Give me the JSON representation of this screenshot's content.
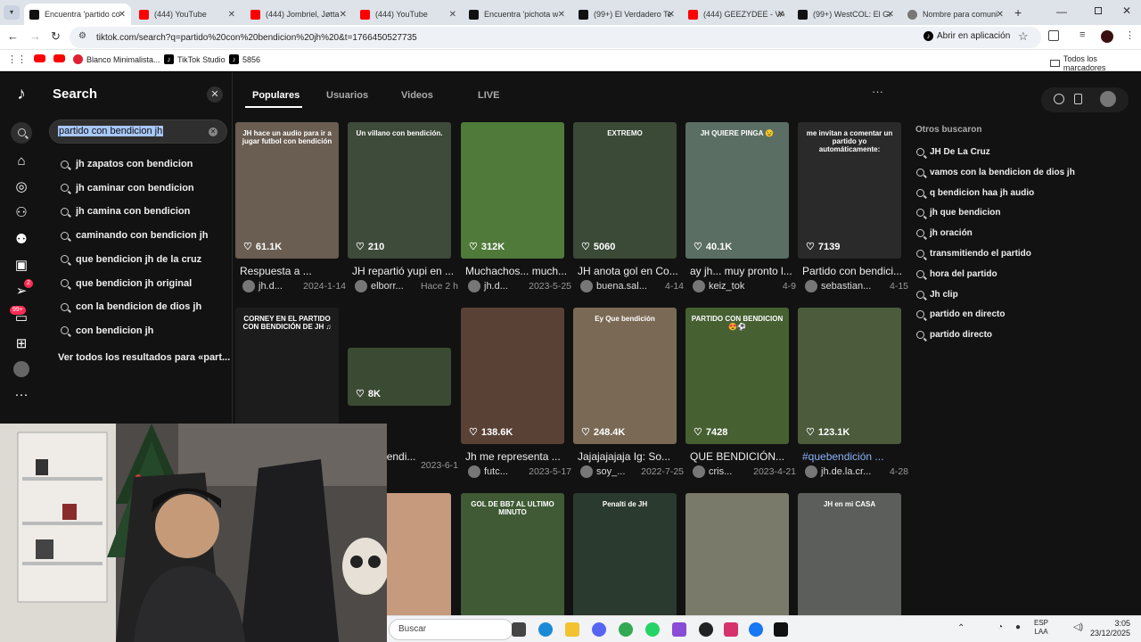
{
  "browser": {
    "tabs": [
      {
        "label": "Encuentra 'partido co",
        "icon": "tiktok-icon",
        "active": true
      },
      {
        "label": "(444) YouTube",
        "icon": "youtube-icon"
      },
      {
        "label": "(444) Jombriel, Jøtta",
        "icon": "youtube-icon"
      },
      {
        "label": "(444) YouTube",
        "icon": "youtube-icon"
      },
      {
        "label": "Encuentra 'pichota w",
        "icon": "tiktok-icon"
      },
      {
        "label": "(99+) El Verdadero Te",
        "icon": "tiktok-icon"
      },
      {
        "label": "(444) GEEZYDEE - VA",
        "icon": "youtube-icon"
      },
      {
        "label": "(99+) WestCOL: El Gr",
        "icon": "tiktok-icon"
      },
      {
        "label": "Nombre para comuni",
        "icon": "globe-icon"
      }
    ],
    "new_tab": "+",
    "url": "tiktok.com/search?q=partido%20con%20bendicion%20jh%20&t=1766450527735",
    "open_in_app": "Abrir en aplicación",
    "bookmarks": [
      {
        "label": "",
        "icon": "youtube-icon"
      },
      {
        "label": "",
        "icon": "youtube-icon"
      },
      {
        "label": "Blanco Minimalista...",
        "icon": "canva-icon"
      },
      {
        "label": "TikTok Studio",
        "icon": "tiktok-icon"
      },
      {
        "label": "5856",
        "icon": "tiktok-icon"
      }
    ],
    "all_bookmarks": "Todos los marcadores"
  },
  "search": {
    "title": "Search",
    "query": "partido con bendicion jh",
    "suggestions": [
      "jh zapatos con bendicion",
      "jh caminar con bendicion",
      "jh camina con bendicion",
      "caminando con bendicion jh",
      "que bendicion jh de la cruz",
      "que bendicion jh original",
      "con la bendicion de dios jh",
      "con bendicion jh"
    ],
    "see_all": "Ver todos los resultados para «part..."
  },
  "rail": {
    "messages_badge": "2",
    "inbox_badge": "99+"
  },
  "results_tabs": [
    "Populares",
    "Usuarios",
    "Videos",
    "LIVE"
  ],
  "more": "···",
  "videos": [
    {
      "likes": "61.1K",
      "desc": "Respuesta a ...",
      "user": "jh.d...",
      "date": "2024-1-14",
      "bg": "#6a5d52",
      "overlay": "JH hace un audio para ir a jugar futbol con bendición"
    },
    {
      "likes": "210",
      "desc": "JH repartió yupi en ...",
      "user": "elborr...",
      "date": "Hace 2 h",
      "bg": "#3e4a3a",
      "overlay": "Un villano con bendición."
    },
    {
      "likes": "312K",
      "desc": "Muchachos... much...",
      "user": "jh.d...",
      "date": "2023-5-25",
      "bg": "#4f7a3a",
      "overlay": ""
    },
    {
      "likes": "5060",
      "desc": "JH anota gol en Co...",
      "user": "buena.sal...",
      "date": "4-14",
      "bg": "#3a4a36",
      "overlay": "EXTREMO"
    },
    {
      "likes": "40.1K",
      "desc": "ay jh... muy pronto l...",
      "user": "keiz_tok",
      "date": "4-9",
      "bg": "#5a6e63",
      "overlay": "JH QUIERE PINGA 😉"
    },
    {
      "likes": "7139",
      "desc": "Partido con bendici...",
      "user": "sebastian...",
      "date": "4-15",
      "bg": "#2a2a2a",
      "overlay": "me invitan a comentar un partido yo automáticamente:"
    },
    {
      "likes": "",
      "desc": "",
      "user": "",
      "date": "",
      "bg": "#2e3a2c",
      "overlay": "CORNEY EN EL PARTIDO CON BENDICIÓN DE JH ♫"
    },
    {
      "likes": "8K",
      "desc": "ti con bendi...",
      "user": "",
      "date": "2023-6-1",
      "bg": "#3b4a32",
      "overlay": ""
    },
    {
      "likes": "138.6K",
      "desc": "Jh me representa ...",
      "user": "futc...",
      "date": "2023-5-17",
      "bg": "#5a4136",
      "overlay": ""
    },
    {
      "likes": "248.4K",
      "desc": "Jajajajajaja Ig: So...",
      "user": "soy_...",
      "date": "2022-7-25",
      "bg": "#7a6a55",
      "overlay": "Ey Que bendición"
    },
    {
      "likes": "7428",
      "desc": "QUE BENDICIÓN... ",
      "user": "cris...",
      "date": "2023-4-21",
      "bg": "#466032",
      "overlay": "PARTIDO CON BENDICION 😍⚽"
    },
    {
      "likes": "123.1K",
      "desc": "#quebendición ...",
      "user": "jh.de.la.cr...",
      "date": "4-28",
      "bg": "#4b5b3c",
      "overlay": ""
    },
    {
      "likes": "",
      "desc": "",
      "user": "",
      "date": "",
      "bg": "#c69a7c",
      "overlay": ""
    },
    {
      "likes": "",
      "desc": "",
      "user": "",
      "date": "",
      "bg": "#3f5a34",
      "overlay": "GOL DE BB7 AL ULTIMO MINUTO"
    },
    {
      "likes": "",
      "desc": "",
      "user": "",
      "date": "",
      "bg": "#2a3a2e",
      "overlay": "Penalti de JH"
    },
    {
      "likes": "",
      "desc": "",
      "user": "",
      "date": "",
      "bg": "#7a7a6a",
      "overlay": ""
    },
    {
      "likes": "",
      "desc": "",
      "user": "",
      "date": "",
      "bg": "#5b5e5a",
      "overlay": "JH en mi CASA"
    }
  ],
  "others": {
    "title": "Otros buscaron",
    "items": [
      "JH De La Cruz",
      "vamos con la bendicion de dios jh",
      "q bendicion haa jh audio",
      "jh que bendicion",
      "jh oración",
      "transmitiendo el partido",
      "hora del partido",
      "Jh clip",
      "partido en directo",
      "partido directo"
    ]
  },
  "taskbar": {
    "search_placeholder": "Buscar",
    "lang_top": "ESP",
    "lang_bottom": "LAA",
    "time": "3:05",
    "date": "23/12/2025"
  }
}
